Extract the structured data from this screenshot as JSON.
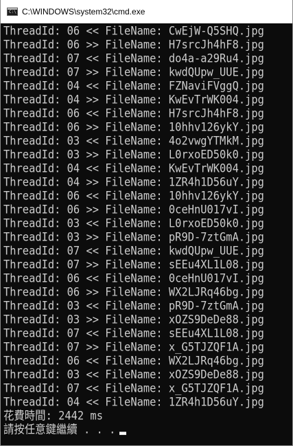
{
  "window": {
    "title": "C:\\WINDOWS\\system32\\cmd.exe",
    "icon": "cmd-icon",
    "icon_prompt": "C:\\"
  },
  "console": {
    "lines": [
      "ThreadId: 06 << FileName: CwEjW-Q5SHQ.jpg",
      "ThreadId: 06 >> FileName: H7srcJh4hF8.jpg",
      "ThreadId: 07 << FileName: do4a-a29Ru4.jpg",
      "ThreadId: 07 >> FileName: kwdQUpw_UUE.jpg",
      "ThreadId: 04 << FileName: FZNaviFVggQ.jpg",
      "ThreadId: 04 >> FileName: KwEvTrWK004.jpg",
      "ThreadId: 06 << FileName: H7srcJh4hF8.jpg",
      "ThreadId: 06 >> FileName: 10hhv126ykY.jpg",
      "ThreadId: 03 << FileName: 4o2vwgYTMkM.jpg",
      "ThreadId: 03 >> FileName: L0rxoED50k0.jpg",
      "ThreadId: 04 << FileName: KwEvTrWK004.jpg",
      "ThreadId: 04 >> FileName: 1ZR4h1D56uY.jpg",
      "ThreadId: 06 << FileName: 10hhv126ykY.jpg",
      "ThreadId: 06 >> FileName: 0ceHnU017vI.jpg",
      "ThreadId: 03 << FileName: L0rxoED50k0.jpg",
      "ThreadId: 03 >> FileName: pR9D-7ztGmA.jpg",
      "ThreadId: 07 << FileName: kwdQUpw_UUE.jpg",
      "ThreadId: 07 >> FileName: sEEu4XL1L08.jpg",
      "ThreadId: 06 << FileName: 0ceHnU017vI.jpg",
      "ThreadId: 06 >> FileName: WX2LJRq46bg.jpg",
      "ThreadId: 03 << FileName: pR9D-7ztGmA.jpg",
      "ThreadId: 03 >> FileName: xOZS9DeDe88.jpg",
      "ThreadId: 07 << FileName: sEEu4XL1L08.jpg",
      "ThreadId: 07 >> FileName: x_G5TJZQF1A.jpg",
      "ThreadId: 06 << FileName: WX2LJRq46bg.jpg",
      "ThreadId: 03 << FileName: xOZS9DeDe88.jpg",
      "ThreadId: 07 << FileName: x_G5TJZQF1A.jpg",
      "ThreadId: 04 << FileName: 1ZR4h1D56uY.jpg",
      "花費時間: 2442 ms"
    ],
    "prompt_line": "請按任意鍵繼續 . . ."
  },
  "colors": {
    "background": "#0c0c0c",
    "foreground": "#cccccc",
    "titlebar": "#ffffff"
  }
}
